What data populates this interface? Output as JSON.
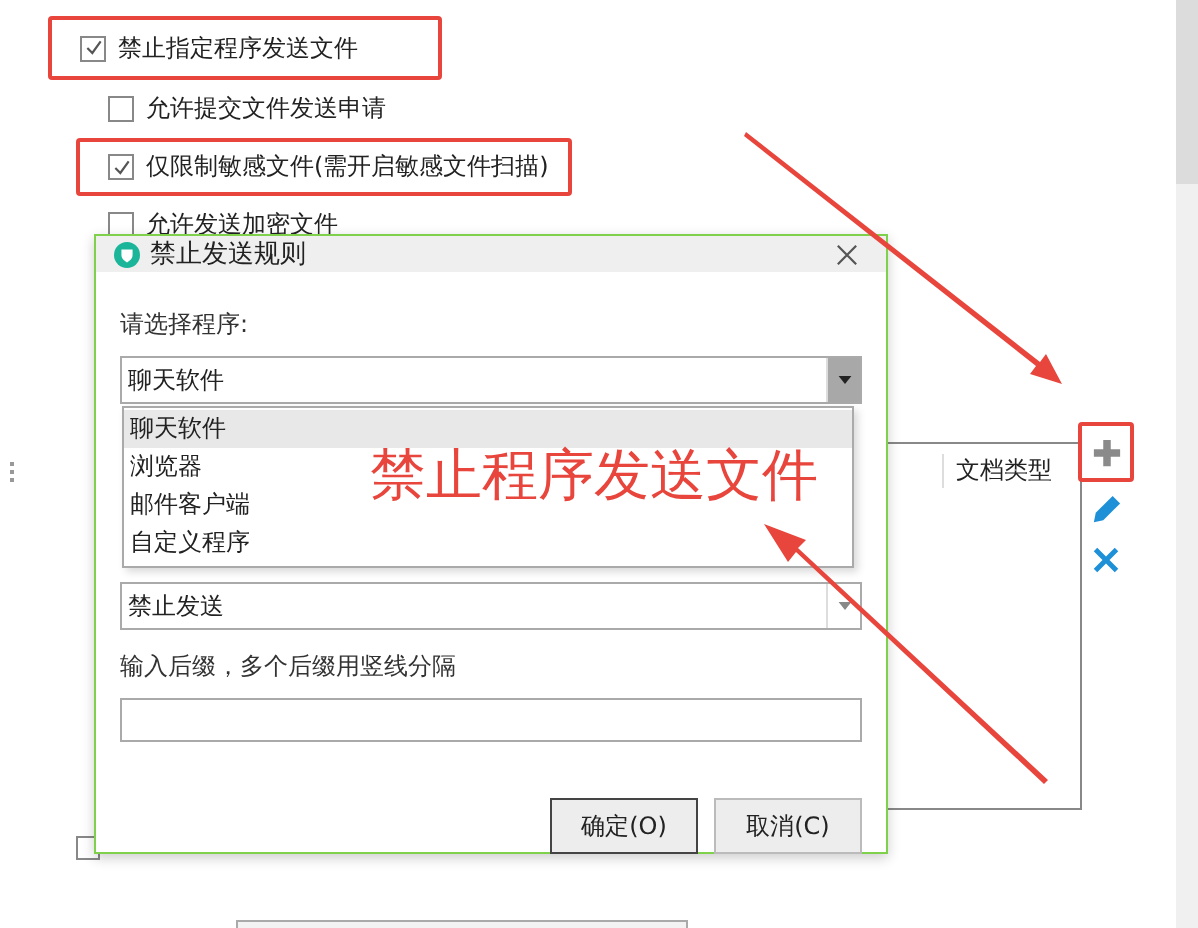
{
  "options": [
    {
      "label": "禁止指定程序发送文件",
      "checked": true,
      "annotated": true,
      "children": [
        {
          "label": "允许提交文件发送申请",
          "checked": false,
          "annotated": false
        },
        {
          "label": "仅限制敏感文件(需开启敏感文件扫描)",
          "checked": true,
          "annotated": true
        },
        {
          "label": "允许发送加密文件",
          "checked": false,
          "annotated": false
        }
      ]
    }
  ],
  "table": {
    "columns": [
      "文档类型"
    ]
  },
  "bottom_checkbox": {
    "checked": false
  },
  "toolbar": [
    {
      "kind": "add",
      "annotated": true
    },
    {
      "kind": "edit",
      "annotated": false
    },
    {
      "kind": "delete",
      "annotated": false
    }
  ],
  "dialog": {
    "title": "禁止发送规则",
    "program_label": "请选择程序:",
    "program_value": "聊天软件",
    "program_options": [
      {
        "label": "聊天软件",
        "selected": true
      },
      {
        "label": "浏览器",
        "selected": false
      },
      {
        "label": "邮件客户端",
        "selected": false
      },
      {
        "label": "自定义程序",
        "selected": false
      }
    ],
    "action_value": "禁止发送",
    "suffix_label": "输入后缀，多个后缀用竖线分隔",
    "buttons": [
      "确定(O)",
      "取消(C)"
    ]
  },
  "annotation": {
    "text": "禁止程序发送文件"
  }
}
